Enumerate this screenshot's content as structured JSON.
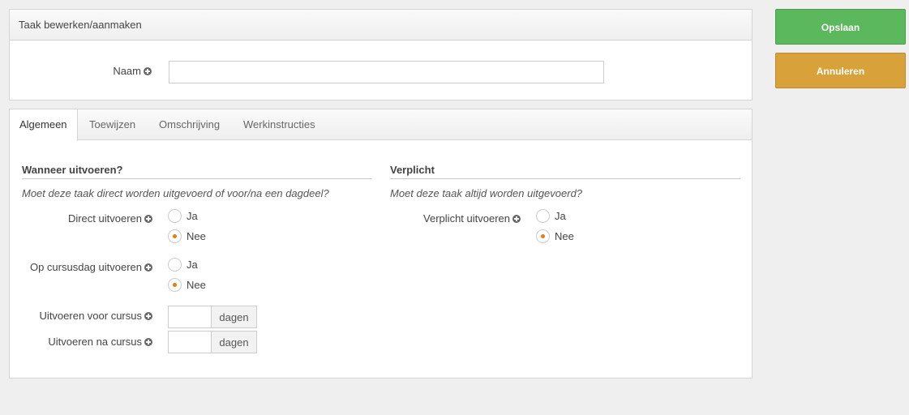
{
  "edit_panel": {
    "title": "Taak bewerken/aanmaken",
    "naam_label": "Naam",
    "naam_value": ""
  },
  "tabs": [
    {
      "label": "Algemeen",
      "active": true
    },
    {
      "label": "Toewijzen",
      "active": false
    },
    {
      "label": "Omschrijving",
      "active": false
    },
    {
      "label": "Werkinstructies",
      "active": false
    }
  ],
  "wanneer": {
    "title": "Wanneer uitvoeren?",
    "hint": "Moet deze taak direct worden uitgevoerd of voor/na een dagdeel?",
    "direct": {
      "label": "Direct uitvoeren",
      "options": [
        "Ja",
        "Nee"
      ],
      "selected": "Nee"
    },
    "cursusdag": {
      "label": "Op cursusdag uitvoeren",
      "options": [
        "Ja",
        "Nee"
      ],
      "selected": "Nee"
    },
    "voor": {
      "label": "Uitvoeren voor cursus",
      "value": "",
      "unit": "dagen"
    },
    "na": {
      "label": "Uitvoeren na cursus",
      "value": "",
      "unit": "dagen"
    }
  },
  "verplicht": {
    "title": "Verplicht",
    "hint": "Moet deze taak altijd worden uitgevoerd?",
    "field": {
      "label": "Verplicht uitvoeren",
      "options": [
        "Ja",
        "Nee"
      ],
      "selected": "Nee"
    }
  },
  "actions": {
    "save": "Opslaan",
    "cancel": "Annuleren"
  },
  "colors": {
    "save": "#5cb85c",
    "cancel": "#d9a13a",
    "radio_dot": "#e87a12"
  }
}
